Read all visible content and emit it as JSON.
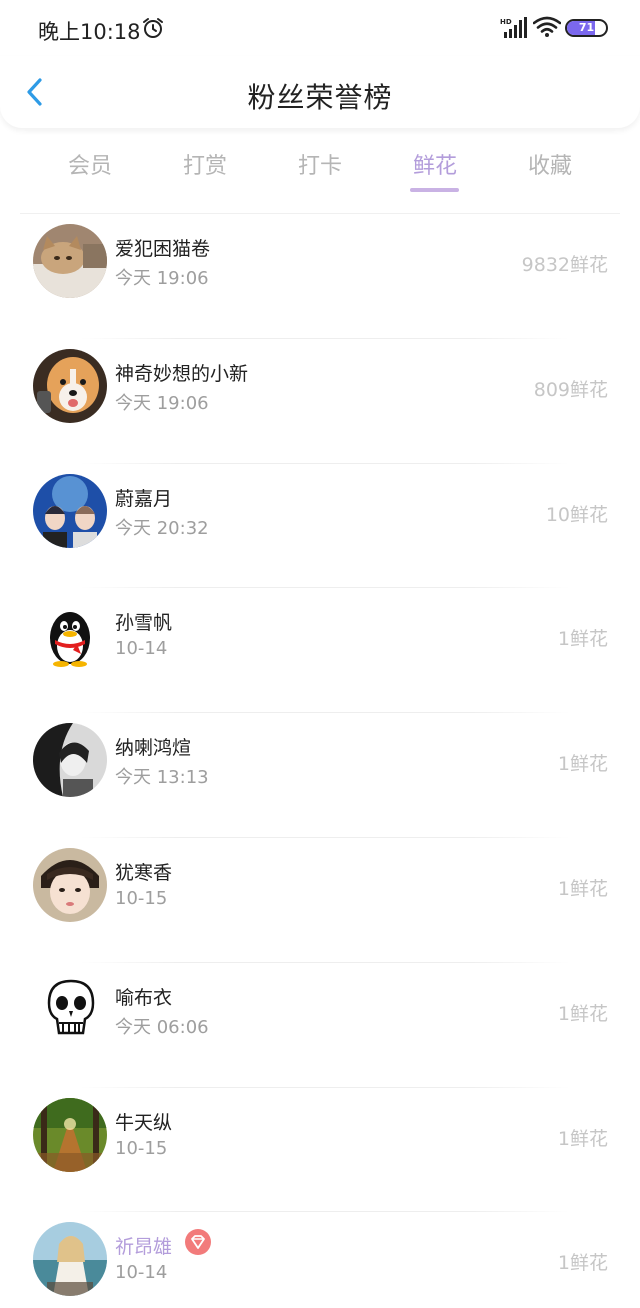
{
  "status_bar": {
    "time": "晚上10:18",
    "battery": "71",
    "battery_level": 0.71,
    "battery_color": "#7b68ee",
    "icons": [
      "alarm-icon",
      "hd-signal-icon",
      "wifi-icon",
      "battery-icon"
    ]
  },
  "header": {
    "title": "粉丝荣誉榜",
    "back_icon": "chevron-left-icon",
    "accent_color": "#2e9be6"
  },
  "tabs": [
    {
      "label": "会员",
      "active": false
    },
    {
      "label": "打赏",
      "active": false
    },
    {
      "label": "打卡",
      "active": false
    },
    {
      "label": "鲜花",
      "active": true
    },
    {
      "label": "收藏",
      "active": false
    }
  ],
  "active_tab_color": "#b39ddb",
  "list": [
    {
      "name": "爱犯困猫卷",
      "time": "今天 19:06",
      "count": "9832鲜花",
      "avatar": "cat-avatar"
    },
    {
      "name": "神奇妙想的小新",
      "time": "今天 19:06",
      "count": "809鲜花",
      "avatar": "dog-avatar"
    },
    {
      "name": "蔚嘉月",
      "time": "今天 20:32",
      "count": "10鲜花",
      "avatar": "blue-photo-avatar"
    },
    {
      "name": "孙雪帆",
      "time": "10-14",
      "count": "1鲜花",
      "avatar": "penguin-avatar"
    },
    {
      "name": "纳喇鸿煊",
      "time": "今天 13:13",
      "count": "1鲜花",
      "avatar": "bw-girl-avatar"
    },
    {
      "name": "犹寒香",
      "time": "10-15",
      "count": "1鲜花",
      "avatar": "girl-photo-avatar"
    },
    {
      "name": "喻布衣",
      "time": "今天 06:06",
      "count": "1鲜花",
      "avatar": "skull-avatar"
    },
    {
      "name": "牛天纵",
      "time": "10-15",
      "count": "1鲜花",
      "avatar": "forest-avatar"
    },
    {
      "name": "祈昂雄",
      "time": "10-14",
      "count": "1鲜花",
      "avatar": "beach-girl-avatar",
      "badge": "diamond-badge-icon",
      "highlight": true
    }
  ]
}
